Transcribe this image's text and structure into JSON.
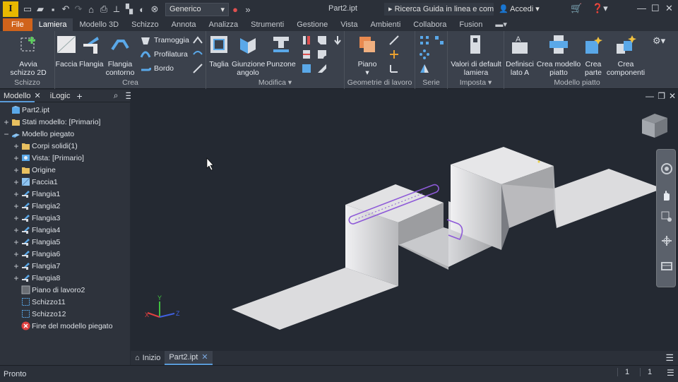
{
  "app": {
    "name": "Autodesk Inventor",
    "doc_title": "Part2.ipt"
  },
  "titlebar": {
    "material": "Generico",
    "search": "Ricerca Guida in linea e comand",
    "login": "Accedi"
  },
  "tabs": [
    "File",
    "Lamiera",
    "Modello 3D",
    "Schizzo",
    "Annota",
    "Analizza",
    "Strumenti",
    "Gestione",
    "Vista",
    "Ambienti",
    "Collabora",
    "Fusion"
  ],
  "active_tab": "Lamiera",
  "ribbon": {
    "groups": [
      {
        "label": "Schizzo"
      },
      {
        "label": "Crea"
      },
      {
        "label": "Modifica ▾"
      },
      {
        "label": "Geometrie di lavoro"
      },
      {
        "label": "Serie"
      },
      {
        "label": "Imposta ▾"
      },
      {
        "label": "Modello piatto"
      }
    ],
    "buttons": {
      "avvia_schizzo": "Avvia\nschizzo 2D",
      "faccia": "Faccia",
      "flangia": "Flangia",
      "flangia_contorno": "Flangia\ncontorno",
      "tramoggia": "Tramoggia",
      "profilatura": "Profilatura",
      "bordo": "Bordo",
      "taglia": "Taglia",
      "giunzione_angolo": "Giunzione\nangolo",
      "punzone": "Punzone",
      "piano": "Piano",
      "valori_default": "Valori di default\nlamiera",
      "definisci_lato": "Definisci\nlato A",
      "crea_modello_piatto": "Crea modello\npiatto",
      "crea_parte": "Crea\nparte",
      "crea_componenti": "Crea\ncomponenti"
    }
  },
  "browser": {
    "tabs": [
      "Modello",
      "iLogic"
    ],
    "nodes": [
      {
        "label": "Part2.ipt",
        "level": 0,
        "expander": "",
        "icon": "part-icon"
      },
      {
        "label": "Stati modello: [Primario]",
        "level": 0,
        "expander": "+",
        "icon": "folder-icon"
      },
      {
        "label": "Modello piegato",
        "level": 0,
        "expander": "−",
        "icon": "sheetmetal-icon"
      },
      {
        "label": "Corpi solidi(1)",
        "level": 1,
        "expander": "+",
        "icon": "folder-icon"
      },
      {
        "label": "Vista: [Primario]",
        "level": 1,
        "expander": "+",
        "icon": "view-icon"
      },
      {
        "label": "Origine",
        "level": 1,
        "expander": "+",
        "icon": "folder-icon"
      },
      {
        "label": "Faccia1",
        "level": 1,
        "expander": "+",
        "icon": "face-icon"
      },
      {
        "label": "Flangia1",
        "level": 1,
        "expander": "+",
        "icon": "flange-icon"
      },
      {
        "label": "Flangia2",
        "level": 1,
        "expander": "+",
        "icon": "flange-icon"
      },
      {
        "label": "Flangia3",
        "level": 1,
        "expander": "+",
        "icon": "flange-icon"
      },
      {
        "label": "Flangia4",
        "level": 1,
        "expander": "+",
        "icon": "flange-icon"
      },
      {
        "label": "Flangia5",
        "level": 1,
        "expander": "+",
        "icon": "flange-icon"
      },
      {
        "label": "Flangia6",
        "level": 1,
        "expander": "+",
        "icon": "flange-icon"
      },
      {
        "label": "Flangia7",
        "level": 1,
        "expander": "+",
        "icon": "flange-icon"
      },
      {
        "label": "Flangia8",
        "level": 1,
        "expander": "+",
        "icon": "flange-icon"
      },
      {
        "label": "Piano di lavoro2",
        "level": 1,
        "expander": "",
        "icon": "workplane-icon"
      },
      {
        "label": "Schizzo11",
        "level": 1,
        "expander": "",
        "icon": "sketch-icon"
      },
      {
        "label": "Schizzo12",
        "level": 1,
        "expander": "",
        "icon": "sketch-icon"
      },
      {
        "label": "Fine del modello piegato",
        "level": 1,
        "expander": "",
        "icon": "end-of-part-icon"
      }
    ]
  },
  "doctabs": {
    "home": "Inizio",
    "doc": "Part2.ipt"
  },
  "statusbar": {
    "text": "Pronto",
    "count1": "1",
    "count2": "1"
  },
  "axes": {
    "x": "X",
    "y": "Y",
    "z": "Z"
  },
  "colors": {
    "accent_file": "#d0631b",
    "sketch_purple": "#8e5ad8",
    "part_face": "#cfd0d2"
  }
}
